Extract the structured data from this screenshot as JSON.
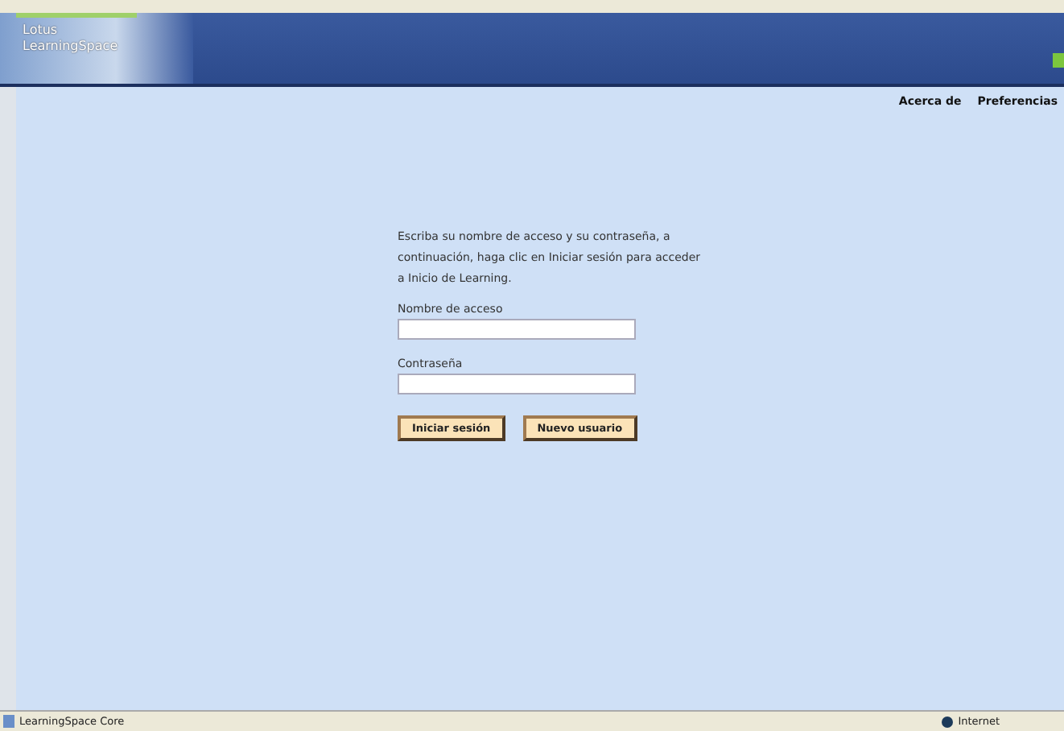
{
  "header": {
    "logo_lines": [
      "Lotus",
      "LearningSpace"
    ]
  },
  "nav": [
    "Acerca de",
    "Preferencias"
  ],
  "intro": "Escriba su nombre de acceso y su contraseña, a continuación, haga clic en Iniciar sesión para acceder a Inicio de Learning.",
  "fields": [
    {
      "label": "Nombre de acceso"
    },
    {
      "label": "Contraseña"
    }
  ],
  "buttons": [
    "Iniciar sesión",
    "Nuevo usuario"
  ],
  "status_bar": {
    "title": "LearningSpace Core",
    "zone": "Internet"
  }
}
